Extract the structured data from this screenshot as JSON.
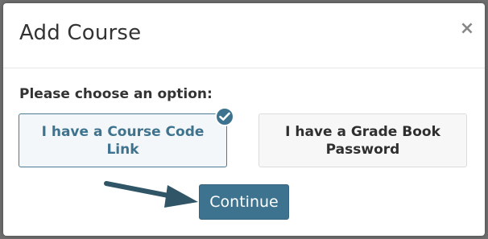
{
  "dialog": {
    "title": "Add Course",
    "close_label": "×"
  },
  "prompt": "Please choose an option:",
  "options": [
    {
      "label": "I have a Course Code Link",
      "selected": true
    },
    {
      "label": "I have a Grade Book Password",
      "selected": false
    }
  ],
  "continue_label": "Continue",
  "colors": {
    "accent": "#3e7390",
    "arrow": "#2f5566"
  },
  "icons": {
    "close": "close-icon",
    "check": "check-icon",
    "arrow": "arrow-icon"
  }
}
